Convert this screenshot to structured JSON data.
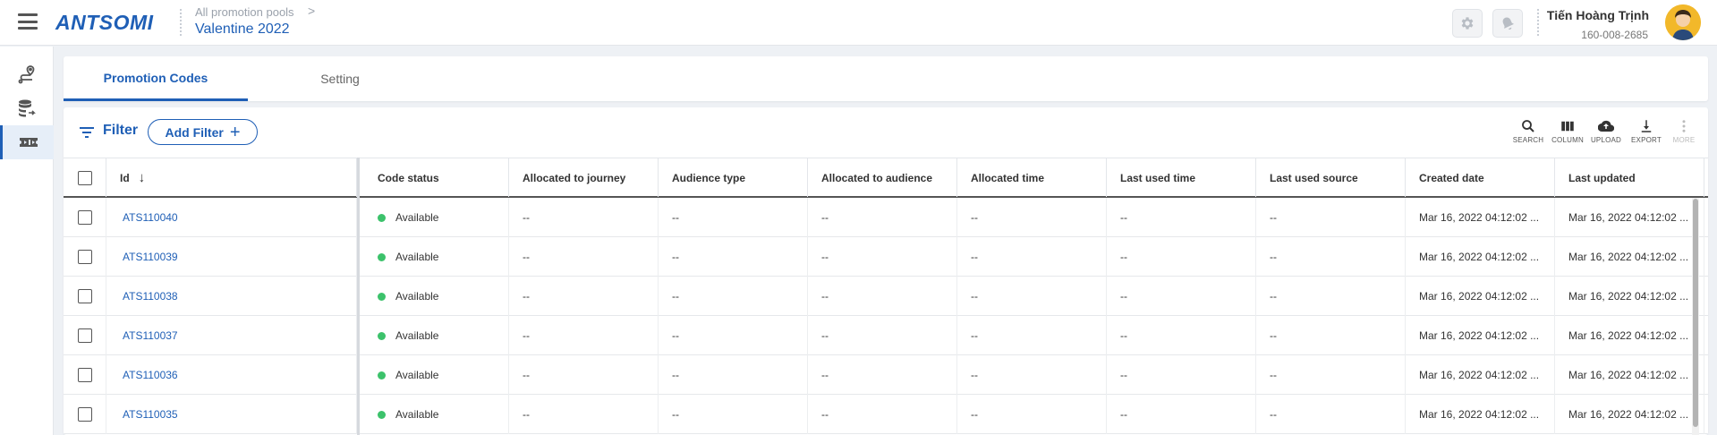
{
  "header": {
    "logo": "ANTSOMI",
    "breadcrumb_parent": "All promotion pools",
    "breadcrumb_chevron": ">",
    "page_title": "Valentine 2022",
    "user_name": "Tiến Hoàng Trịnh",
    "user_id": "160-008-2685",
    "icons": [
      "gear-icon",
      "bell-icon"
    ]
  },
  "sidebar": {
    "items": [
      {
        "icon": "journey-icon",
        "active": false
      },
      {
        "icon": "data-transfer-icon",
        "active": false
      },
      {
        "icon": "ticket-icon",
        "active": true
      }
    ]
  },
  "tabs": [
    {
      "label": "Promotion Codes",
      "active": true
    },
    {
      "label": "Setting",
      "active": false
    }
  ],
  "toolbar": {
    "filter_label": "Filter",
    "add_filter_label": "Add Filter",
    "add_filter_plus": "+",
    "tools": [
      {
        "label": "SEARCH",
        "icon": "search-icon",
        "enabled": true
      },
      {
        "label": "COLUMN",
        "icon": "column-icon",
        "enabled": true
      },
      {
        "label": "UPLOAD",
        "icon": "upload-icon",
        "enabled": true
      },
      {
        "label": "EXPORT",
        "icon": "export-icon",
        "enabled": true
      },
      {
        "label": "MORE",
        "icon": "more-icon",
        "enabled": false
      }
    ]
  },
  "table": {
    "sort_arrow": "↓",
    "columns": [
      "Id",
      "Code status",
      "Allocated to journey",
      "Audience type",
      "Allocated to audience",
      "Allocated time",
      "Last used time",
      "Last used source",
      "Created date",
      "Last updated"
    ],
    "rows": [
      [
        "ATS110040",
        "Available",
        "--",
        "--",
        "--",
        "--",
        "--",
        "--",
        "Mar 16, 2022 04:12:02 ...",
        "Mar 16, 2022 04:12:02 ..."
      ],
      [
        "ATS110039",
        "Available",
        "--",
        "--",
        "--",
        "--",
        "--",
        "--",
        "Mar 16, 2022 04:12:02 ...",
        "Mar 16, 2022 04:12:02 ..."
      ],
      [
        "ATS110038",
        "Available",
        "--",
        "--",
        "--",
        "--",
        "--",
        "--",
        "Mar 16, 2022 04:12:02 ...",
        "Mar 16, 2022 04:12:02 ..."
      ],
      [
        "ATS110037",
        "Available",
        "--",
        "--",
        "--",
        "--",
        "--",
        "--",
        "Mar 16, 2022 04:12:02 ...",
        "Mar 16, 2022 04:12:02 ..."
      ],
      [
        "ATS110036",
        "Available",
        "--",
        "--",
        "--",
        "--",
        "--",
        "--",
        "Mar 16, 2022 04:12:02 ...",
        "Mar 16, 2022 04:12:02 ..."
      ],
      [
        "ATS110035",
        "Available",
        "--",
        "--",
        "--",
        "--",
        "--",
        "--",
        "Mar 16, 2022 04:12:02 ...",
        "Mar 16, 2022 04:12:02 ..."
      ]
    ]
  },
  "colors": {
    "accent": "#1f5fb6",
    "status_available": "#3cc26b"
  }
}
